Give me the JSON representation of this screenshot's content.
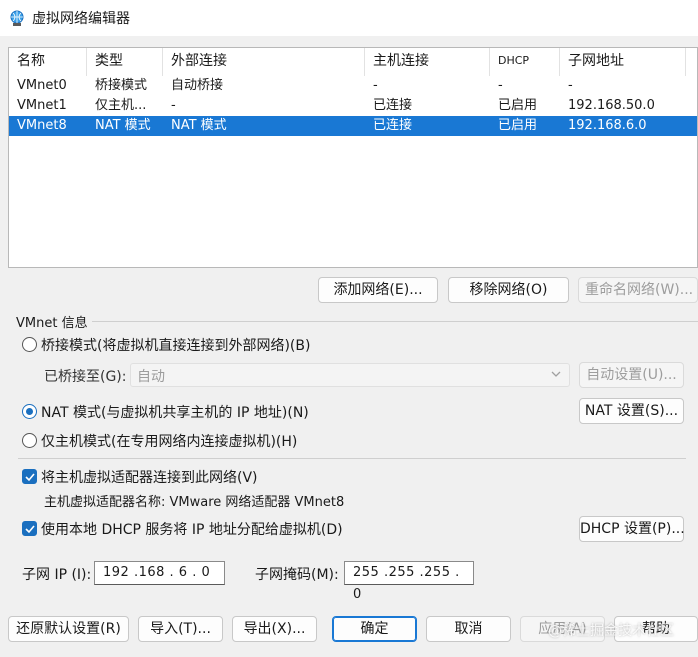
{
  "window": {
    "title": "虚拟网络编辑器"
  },
  "table": {
    "columns": [
      "名称",
      "类型",
      "外部连接",
      "主机连接",
      "DHCP",
      "子网地址"
    ],
    "rows": [
      {
        "name": "VMnet0",
        "type": "桥接模式",
        "external": "自动桥接",
        "host": "-",
        "dhcp": "-",
        "subnet": "-"
      },
      {
        "name": "VMnet1",
        "type": "仅主机...",
        "external": "-",
        "host": "已连接",
        "dhcp": "已启用",
        "subnet": "192.168.50.0"
      },
      {
        "name": "VMnet8",
        "type": "NAT 模式",
        "external": "NAT 模式",
        "host": "已连接",
        "dhcp": "已启用",
        "subnet": "192.168.6.0"
      }
    ],
    "selected_row": 2
  },
  "list_buttons": {
    "add": "添加网络(E)...",
    "remove": "移除网络(O)",
    "rename": "重命名网络(W)..."
  },
  "vmnet_info": {
    "group_label": "VMnet 信息",
    "bridge_radio": "桥接模式(将虚拟机直接连接到外部网络)(B)",
    "bridged_to_label": "已桥接至(G):",
    "bridged_to_value": "自动",
    "auto_settings": "自动设置(U)...",
    "nat_radio": "NAT 模式(与虚拟机共享主机的 IP 地址)(N)",
    "nat_settings": "NAT 设置(S)...",
    "hostonly_radio": "仅主机模式(在专用网络内连接虚拟机)(H)",
    "selected_mode": "nat",
    "connect_adapter": "将主机虚拟适配器连接到此网络(V)",
    "adapter_name": "主机虚拟适配器名称: VMware 网络适配器 VMnet8",
    "use_dhcp": "使用本地 DHCP 服务将 IP 地址分配给虚拟机(D)",
    "dhcp_settings": "DHCP 设置(P)...",
    "connect_adapter_checked": true,
    "use_dhcp_checked": true,
    "subnet_ip_label": "子网 IP (I):",
    "subnet_ip": "192 .168 . 6 . 0",
    "subnet_mask_label": "子网掩码(M):",
    "subnet_mask": "255 .255 .255 . 0"
  },
  "footer": {
    "restore": "还原默认设置(R)",
    "import": "导入(T)...",
    "export": "导出(X)...",
    "ok": "确定",
    "cancel": "取消",
    "apply": "应用(A)",
    "help": "帮助"
  },
  "watermark": "@稀土掘金技术社区",
  "colors": {
    "selection": "#1978d4",
    "accent": "#1a6fbf"
  }
}
